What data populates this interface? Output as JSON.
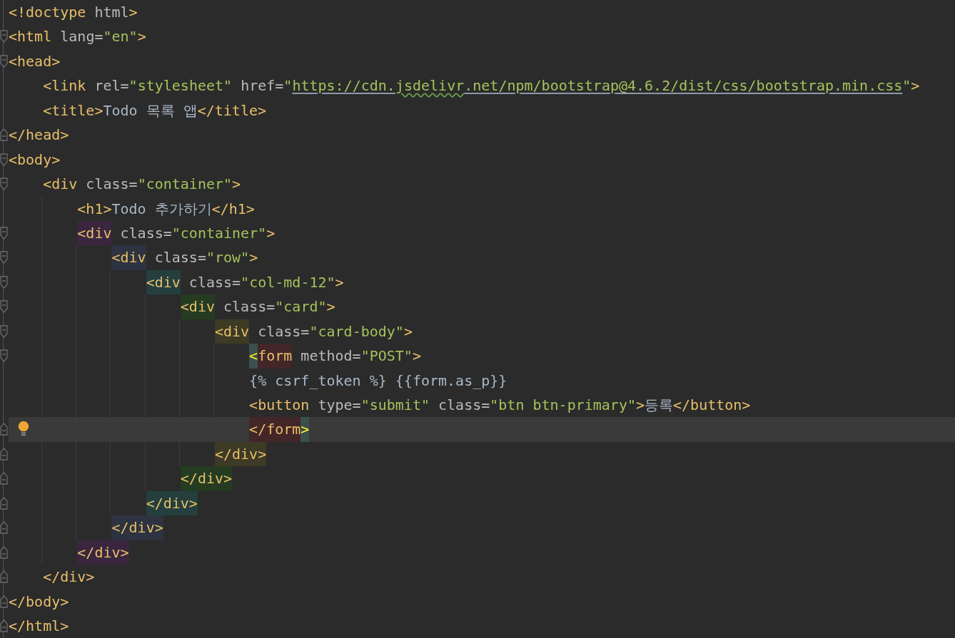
{
  "lines": [
    {
      "fold_open": false,
      "fold_close": false,
      "current": false,
      "tokens": [
        {
          "kind": "tag",
          "text": "<!doctype"
        },
        {
          "kind": "attr",
          "text": " html"
        },
        {
          "kind": "tag",
          "text": ">"
        }
      ]
    },
    {
      "fold_open": true,
      "fold_close": false,
      "current": false,
      "tokens": [
        {
          "kind": "tag",
          "text": "<html"
        },
        {
          "kind": "attr",
          "text": " lang="
        },
        {
          "kind": "string",
          "text": "\"en\""
        },
        {
          "kind": "tag",
          "text": ">"
        }
      ]
    },
    {
      "fold_open": true,
      "fold_close": false,
      "current": false,
      "tokens": [
        {
          "kind": "tag",
          "text": "<head>"
        }
      ],
      "children": [
        {
          "fold_open": false,
          "fold_close": false,
          "current": false,
          "tokens": [
            {
              "kind": "tag",
              "text": "<link"
            },
            {
              "kind": "attr",
              "text": " rel="
            },
            {
              "kind": "string",
              "text": "\"stylesheet\""
            },
            {
              "kind": "attr",
              "text": " href="
            },
            {
              "kind": "string",
              "text": "\""
            },
            {
              "kind": "link",
              "text": "https://cdn."
            },
            {
              "kind": "link-typo",
              "text": "jsdelivr"
            },
            {
              "kind": "link",
              "text": ".net/npm/bootstrap@4.6.2/dist/css/bootstrap.min.css"
            },
            {
              "kind": "string",
              "text": "\""
            },
            {
              "kind": "tag",
              "text": ">"
            }
          ]
        },
        {
          "fold_open": false,
          "fold_close": false,
          "current": false,
          "tokens": [
            {
              "kind": "tag",
              "text": "<title>"
            },
            {
              "kind": "text",
              "text": "Todo 목록 앱"
            },
            {
              "kind": "tag",
              "text": "</title>"
            }
          ]
        }
      ]
    },
    {
      "fold_open": false,
      "fold_close": true,
      "current": false,
      "tokens": [
        {
          "kind": "tag",
          "text": "</head>"
        }
      ]
    },
    {
      "fold_open": true,
      "fold_close": false,
      "current": false,
      "tokens": [
        {
          "kind": "tag",
          "text": "<body>"
        }
      ],
      "children": [
        {
          "fold_open": true,
          "fold_close": false,
          "current": false,
          "tokens": [
            {
              "kind": "tag",
              "text": "<div"
            },
            {
              "kind": "attr",
              "text": " class="
            },
            {
              "kind": "string",
              "text": "\"container\""
            },
            {
              "kind": "tag",
              "text": ">"
            }
          ],
          "children": [
            {
              "fold_open": false,
              "fold_close": false,
              "current": false,
              "tokens": [
                {
                  "kind": "tag",
                  "text": "<h1>"
                },
                {
                  "kind": "text",
                  "text": "Todo 추가하기"
                },
                {
                  "kind": "tag",
                  "text": "</h1>"
                }
              ]
            },
            {
              "fold_open": true,
              "fold_close": false,
              "current": false,
              "tokens": [
                {
                  "kind": "tag",
                  "text": "<div",
                  "color": "#3b2640"
                },
                {
                  "kind": "attr",
                  "text": " class="
                },
                {
                  "kind": "string",
                  "text": "\"container\""
                },
                {
                  "kind": "tag",
                  "text": ">"
                }
              ],
              "children": [
                {
                  "fold_open": true,
                  "fold_close": false,
                  "current": false,
                  "tokens": [
                    {
                      "kind": "tag",
                      "text": "<div",
                      "color": "#2d3340"
                    },
                    {
                      "kind": "attr",
                      "text": " class="
                    },
                    {
                      "kind": "string",
                      "text": "\"row\""
                    },
                    {
                      "kind": "tag",
                      "text": ">"
                    }
                  ],
                  "children": [
                    {
                      "fold_open": true,
                      "fold_close": false,
                      "current": false,
                      "tokens": [
                        {
                          "kind": "tag",
                          "text": "<div",
                          "color": "#243f3e"
                        },
                        {
                          "kind": "attr",
                          "text": " class="
                        },
                        {
                          "kind": "string",
                          "text": "\"col-md-12\""
                        },
                        {
                          "kind": "tag",
                          "text": ">"
                        }
                      ],
                      "children": [
                        {
                          "fold_open": true,
                          "fold_close": false,
                          "current": false,
                          "tokens": [
                            {
                              "kind": "tag",
                              "text": "<div",
                              "color": "#253b22"
                            },
                            {
                              "kind": "attr",
                              "text": " class="
                            },
                            {
                              "kind": "string",
                              "text": "\"card\""
                            },
                            {
                              "kind": "tag",
                              "text": ">"
                            }
                          ],
                          "children": [
                            {
                              "fold_open": true,
                              "fold_close": false,
                              "current": false,
                              "tokens": [
                                {
                                  "kind": "tag",
                                  "text": "<div",
                                  "color": "#3d3a25"
                                },
                                {
                                  "kind": "attr",
                                  "text": " class="
                                },
                                {
                                  "kind": "string",
                                  "text": "\"card-body\""
                                },
                                {
                                  "kind": "tag",
                                  "text": ">"
                                }
                              ],
                              "children": [
                                {
                                  "fold_open": true,
                                  "fold_close": false,
                                  "current": false,
                                  "tokens": [
                                    {
                                      "kind": "brace",
                                      "text": "<",
                                      "color": "#3b504d"
                                    },
                                    {
                                      "kind": "tag",
                                      "text": "form",
                                      "color": "#432628"
                                    },
                                    {
                                      "kind": "attr",
                                      "text": " method="
                                    },
                                    {
                                      "kind": "string",
                                      "text": "\"POST\""
                                    },
                                    {
                                      "kind": "tag",
                                      "text": ">"
                                    }
                                  ]
                                },
                                {
                                  "fold_open": false,
                                  "fold_close": false,
                                  "current": false,
                                  "tokens": [
                                    {
                                      "kind": "text",
                                      "text": "{% csrf_token %} {{form.as_p}}"
                                    }
                                  ]
                                },
                                {
                                  "fold_open": false,
                                  "fold_close": false,
                                  "current": false,
                                  "tokens": [
                                    {
                                      "kind": "tag",
                                      "text": "<button"
                                    },
                                    {
                                      "kind": "attr",
                                      "text": " type="
                                    },
                                    {
                                      "kind": "string",
                                      "text": "\"submit\""
                                    },
                                    {
                                      "kind": "attr",
                                      "text": " class="
                                    },
                                    {
                                      "kind": "string",
                                      "text": "\"btn btn-primary\""
                                    },
                                    {
                                      "kind": "tag",
                                      "text": ">"
                                    },
                                    {
                                      "kind": "text",
                                      "text": "등록"
                                    },
                                    {
                                      "kind": "tag",
                                      "text": "</button>"
                                    }
                                  ]
                                },
                                {
                                  "fold_open": false,
                                  "fold_close": true,
                                  "current": true,
                                  "bulb": true,
                                  "tokens": [
                                    {
                                      "kind": "tag",
                                      "text": "</form",
                                      "color": "#432628"
                                    },
                                    {
                                      "kind": "brace",
                                      "text": ">",
                                      "color": "#3b504d"
                                    }
                                  ]
                                }
                              ]
                            },
                            {
                              "fold_open": false,
                              "fold_close": true,
                              "current": false,
                              "tokens": [
                                {
                                  "kind": "tag",
                                  "text": "</div>",
                                  "color": "#3d3a25"
                                }
                              ]
                            }
                          ]
                        },
                        {
                          "fold_open": false,
                          "fold_close": true,
                          "current": false,
                          "tokens": [
                            {
                              "kind": "tag",
                              "text": "</div>",
                              "color": "#253b22"
                            }
                          ]
                        }
                      ]
                    },
                    {
                      "fold_open": false,
                      "fold_close": true,
                      "current": false,
                      "tokens": [
                        {
                          "kind": "tag",
                          "text": "</div>",
                          "color": "#243f3e"
                        }
                      ]
                    }
                  ]
                },
                {
                  "fold_open": false,
                  "fold_close": true,
                  "current": false,
                  "tokens": [
                    {
                      "kind": "tag",
                      "text": "</div>",
                      "color": "#2d3340"
                    }
                  ]
                }
              ]
            },
            {
              "fold_open": false,
              "fold_close": true,
              "current": false,
              "tokens": [
                {
                  "kind": "tag",
                  "text": "</div>",
                  "color": "#3b2640"
                }
              ]
            }
          ]
        },
        {
          "fold_open": false,
          "fold_close": true,
          "current": false,
          "tokens": [
            {
              "kind": "tag",
              "text": "</div>"
            }
          ]
        }
      ]
    },
    {
      "fold_open": false,
      "fold_close": true,
      "current": false,
      "tokens": [
        {
          "kind": "tag",
          "text": "</body>"
        }
      ]
    },
    {
      "fold_open": false,
      "fold_close": true,
      "current": false,
      "tokens": [
        {
          "kind": "tag",
          "text": "</html>"
        }
      ]
    }
  ]
}
